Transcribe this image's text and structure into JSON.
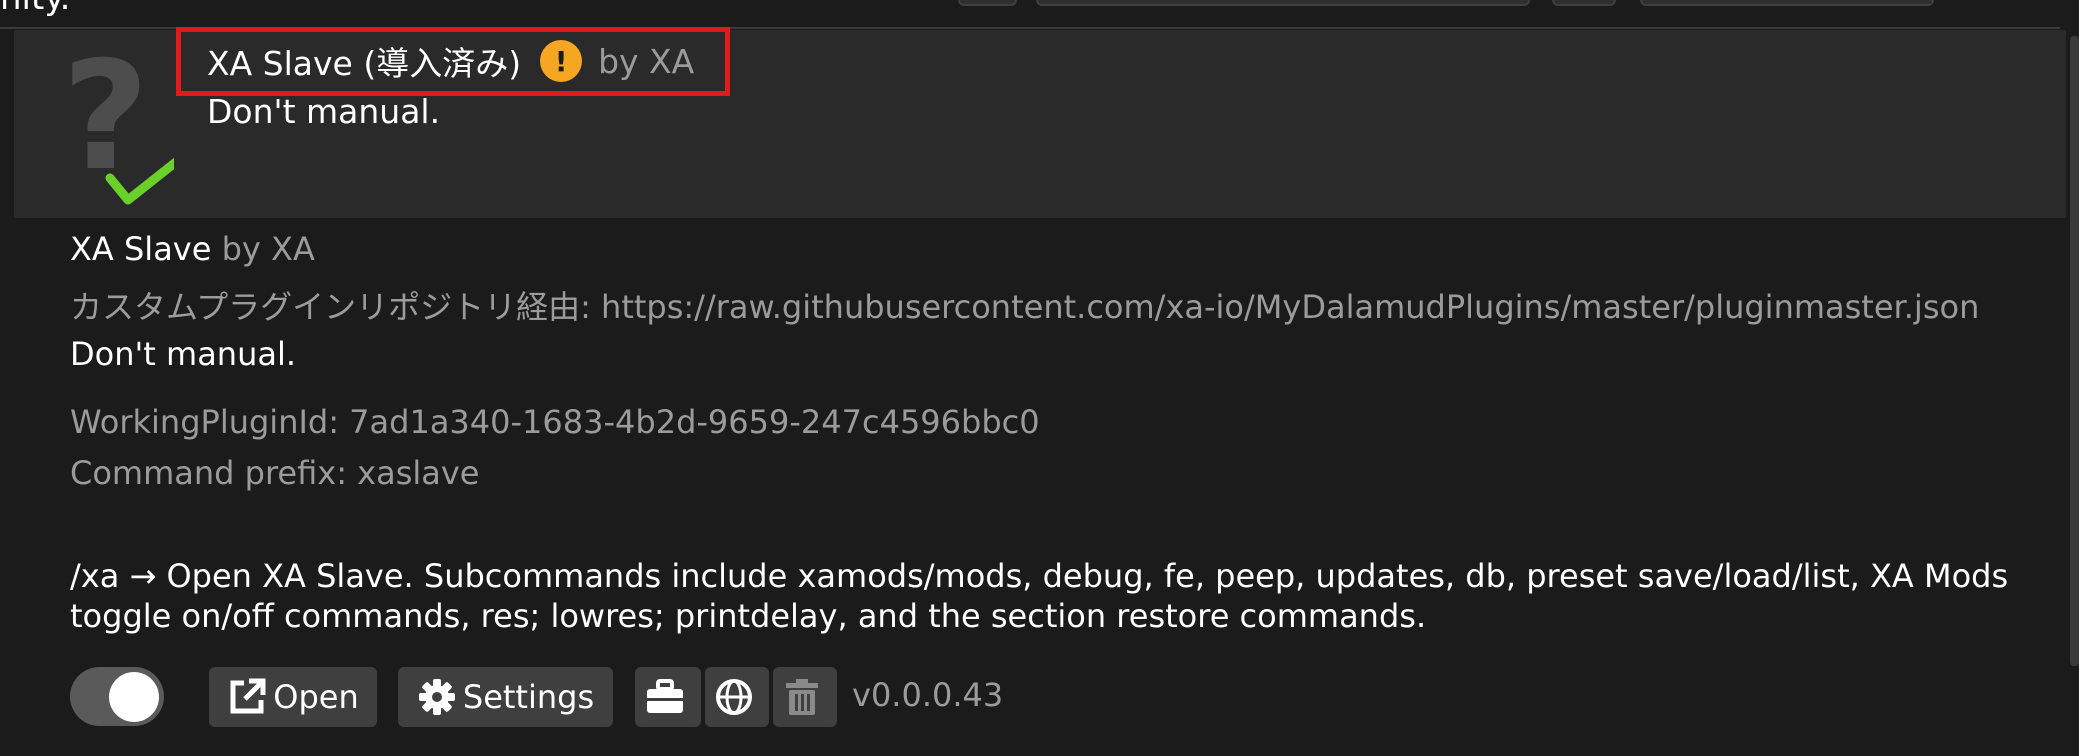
{
  "top_cut_text": "nity.",
  "plugin": {
    "title": "XA Slave (導入済み)",
    "by": "by XA",
    "short_description": "Don't manual.",
    "name": "XA Slave",
    "repo_line": "カスタムプラグインリポジトリ経由: https://raw.githubusercontent.com/xa-io/MyDalamudPlugins/master/pluginmaster.json",
    "description": "Don't manual.",
    "working_plugin_id": "WorkingPluginId: 7ad1a340-1683-4b2d-9659-247c4596bbc0",
    "command_prefix": "Command prefix: xaslave",
    "help_text": "/xa → Open XA Slave. Subcommands include xamods/mods, debug, fe, peep, updates, db, preset save/load/list, XA Mods toggle on/off commands, res; lowres; printdelay, and the section restore commands.",
    "enabled": true,
    "version": "v0.0.0.43"
  },
  "buttons": {
    "open": "Open",
    "settings": "Settings"
  },
  "icons": [
    "question-mark-icon",
    "checkmark-icon",
    "warning-icon",
    "external-link-icon",
    "gear-icon",
    "toolbox-icon",
    "globe-icon",
    "trash-icon"
  ],
  "colors": {
    "background": "#1b1b1b",
    "header_bg": "#2a2a2a",
    "highlight_border": "#e01b1b",
    "warning": "#f5a623",
    "check": "#6bd12a",
    "muted_text": "#9b9b9b"
  }
}
